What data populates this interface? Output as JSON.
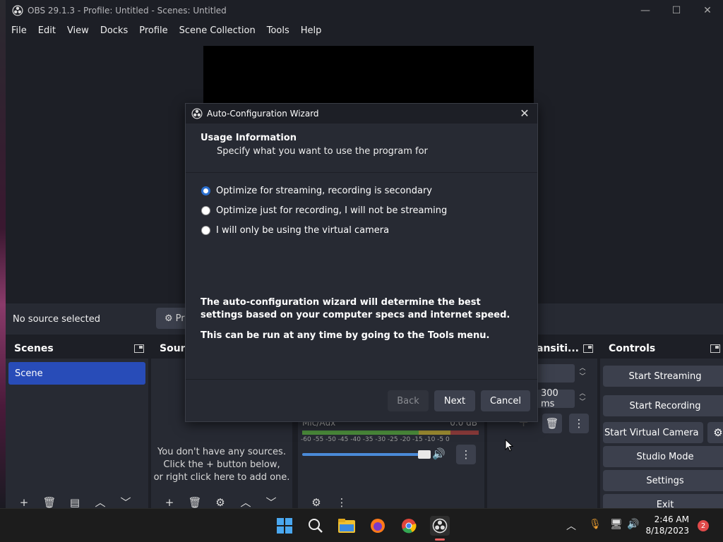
{
  "window": {
    "title": "OBS 29.1.3 - Profile: Untitled - Scenes: Untitled",
    "minimize": "—",
    "maximize": "☐",
    "close": "✕"
  },
  "menu": [
    "File",
    "Edit",
    "View",
    "Docks",
    "Profile",
    "Scene Collection",
    "Tools",
    "Help"
  ],
  "source_bar": {
    "no_source": "No source selected",
    "properties_label": "Pr"
  },
  "docks": {
    "scenes": {
      "title": "Scenes",
      "items": [
        "Scene"
      ]
    },
    "sources": {
      "title": "Sourc",
      "empty_lines": [
        "You don't have any sources.",
        "Click the + button below,",
        "or right click here to add one."
      ]
    },
    "mixer": {
      "channel": "Mic/Aux",
      "db": "0.0 dB",
      "ticks": "-60 -55 -50 -45 -40 -35 -30 -25 -20 -15 -10 -5 0"
    },
    "transitions": {
      "title": "ansiti...",
      "duration": "300 ms"
    },
    "controls": {
      "title": "Controls",
      "buttons": [
        "Start Streaming",
        "Start Recording",
        "Start Virtual Camera",
        "Studio Mode",
        "Settings",
        "Exit"
      ]
    }
  },
  "dialog": {
    "title": "Auto-Configuration Wizard",
    "heading": "Usage Information",
    "subheading": "Specify what you want to use the program for",
    "options": [
      {
        "label": "Optimize for streaming, recording is secondary",
        "checked": true
      },
      {
        "label": "Optimize just for recording, I will not be streaming",
        "checked": false
      },
      {
        "label": "I will only be using the virtual camera",
        "checked": false
      }
    ],
    "note1": "The auto-configuration wizard will determine the best settings based on your computer specs and internet speed.",
    "note2": "This can be run at any time by going to the Tools menu.",
    "back": "Back",
    "next": "Next",
    "cancel": "Cancel"
  },
  "taskbar": {
    "time": "2:46 AM",
    "date": "8/18/2023",
    "notifications": "2"
  },
  "colors": {
    "accent": "#284cb8",
    "radio": "#2a6fd0"
  }
}
